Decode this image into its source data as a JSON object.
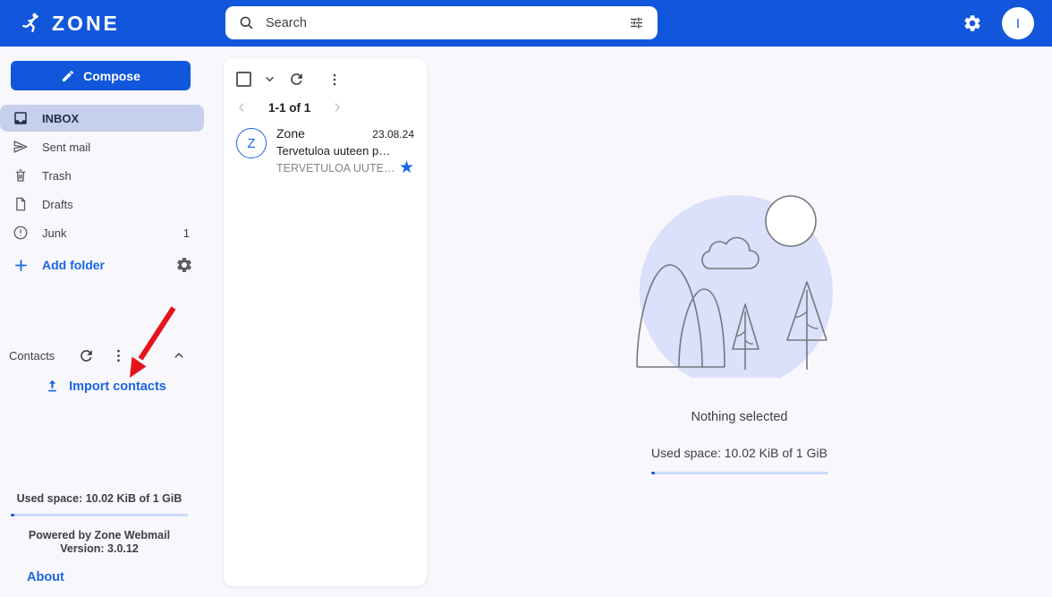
{
  "header": {
    "logo_text": "ZONE",
    "search_placeholder": "Search",
    "avatar_letter": "I"
  },
  "sidebar": {
    "compose_label": "Compose",
    "folders": [
      {
        "label": "INBOX",
        "count": "",
        "selected": true
      },
      {
        "label": "Sent mail",
        "count": ""
      },
      {
        "label": "Trash",
        "count": ""
      },
      {
        "label": "Drafts",
        "count": ""
      },
      {
        "label": "Junk",
        "count": "1"
      }
    ],
    "add_folder_label": "Add folder",
    "contacts": {
      "title": "Contacts",
      "import_label": "Import contacts"
    },
    "footer": {
      "used_space": "Used space: 10.02 KiB of 1 GiB",
      "powered_by": "Powered by Zone Webmail",
      "version": "Version: 3.0.12",
      "about_label": "About"
    }
  },
  "mail_list": {
    "pagination_label": "1-1 of 1",
    "emails": [
      {
        "avatar_letter": "Z",
        "sender": "Zone",
        "date": "23.08.24",
        "subject": "Tervetuloa uuteen p…",
        "preview": "TERVETULOA UUTE…",
        "star_glyph": "★"
      }
    ]
  },
  "main": {
    "empty_title": "Nothing selected",
    "used_space": "Used space: 10.02 KiB of 1 GiB"
  },
  "colors": {
    "accent_blue": "#1257db",
    "link_blue": "#1b66e4",
    "selected_row": "#c6cfeb",
    "star_blue": "#1a66e4",
    "annotation_red": "#e5141c",
    "illustration_fill": "#dbe0fb"
  }
}
